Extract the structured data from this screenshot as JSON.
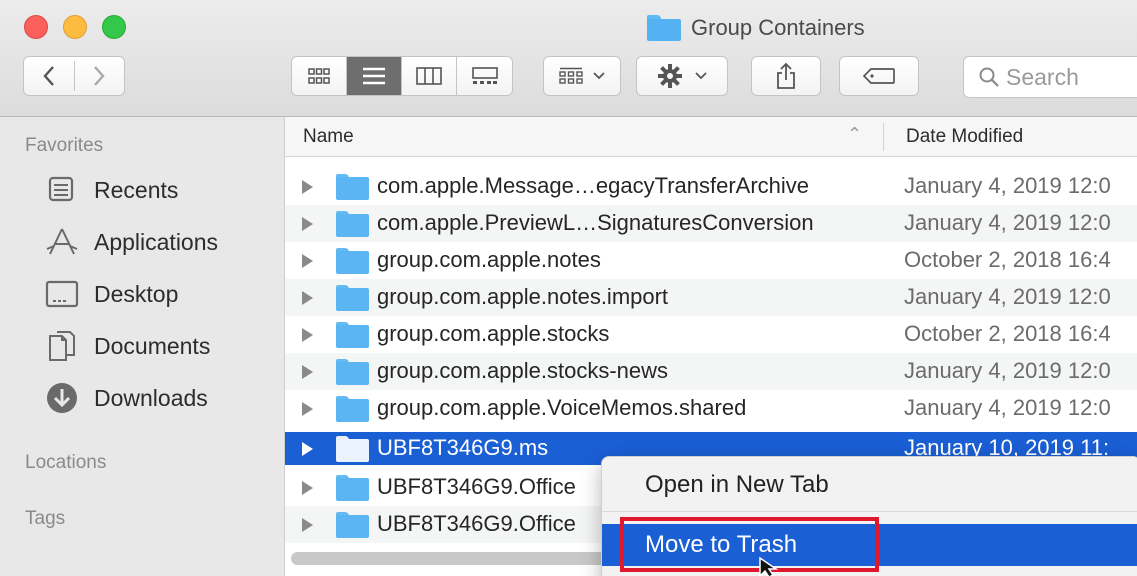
{
  "window": {
    "title": "Group Containers",
    "title_icon": "folder-icon"
  },
  "toolbar": {
    "back_icon": "chevron-left-icon",
    "forward_icon": "chevron-right-icon",
    "view_modes": [
      "icon-view-icon",
      "list-view-icon",
      "column-view-icon",
      "gallery-view-icon"
    ],
    "active_view": "list-view-icon",
    "group_icon": "group-by-icon",
    "action_icon": "gear-icon",
    "share_icon": "share-icon",
    "tags_icon": "tag-icon",
    "search": {
      "placeholder": "Search"
    }
  },
  "sidebar": {
    "favorites_header": "Favorites",
    "favorites": [
      {
        "label": "Recents",
        "icon": "recents-icon"
      },
      {
        "label": "Applications",
        "icon": "applications-icon"
      },
      {
        "label": "Desktop",
        "icon": "desktop-icon"
      },
      {
        "label": "Documents",
        "icon": "documents-icon"
      },
      {
        "label": "Downloads",
        "icon": "downloads-icon"
      }
    ],
    "locations_header": "Locations",
    "tags_header": "Tags"
  },
  "columns": {
    "name": "Name",
    "date": "Date Modified"
  },
  "rows": [
    {
      "name": "com.apple.Message…egacyTransferArchive",
      "date": "January 4, 2019 12:0"
    },
    {
      "name": "com.apple.PreviewL…SignaturesConversion",
      "date": "January 4, 2019 12:0"
    },
    {
      "name": "group.com.apple.notes",
      "date": "October 2, 2018 16:4"
    },
    {
      "name": "group.com.apple.notes.import",
      "date": "January 4, 2019 12:0"
    },
    {
      "name": "group.com.apple.stocks",
      "date": "October 2, 2018 16:4"
    },
    {
      "name": "group.com.apple.stocks-news",
      "date": "January 4, 2019 12:0"
    },
    {
      "name": "group.com.apple.VoiceMemos.shared",
      "date": "January 4, 2019 12:0"
    },
    {
      "name": "UBF8T346G9.ms",
      "date": "January 10, 2019 11:",
      "selected": true
    },
    {
      "name": "UBF8T346G9.Office",
      "date": ""
    },
    {
      "name": "UBF8T346G9.Office",
      "date": ""
    }
  ],
  "context_menu": {
    "items": [
      {
        "label": "Open in New Tab"
      },
      {
        "label": "Move to Trash",
        "highlighted": true
      }
    ]
  },
  "colors": {
    "selection": "#1b5fd5",
    "folder": "#5ab5f2",
    "highlight_outline": "#e0182d"
  }
}
